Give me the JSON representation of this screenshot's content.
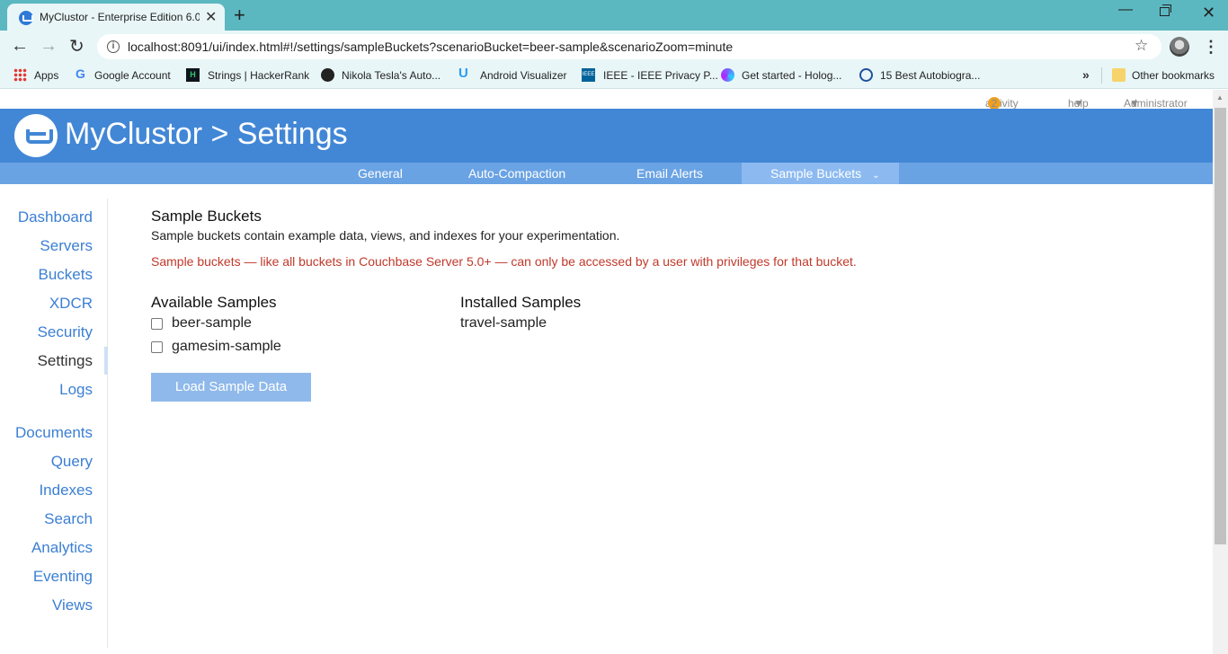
{
  "browser": {
    "tab_title": "MyClustor - Enterprise Edition 6.0",
    "url": "localhost:8091/ui/index.html#!/settings/sampleBuckets?scenarioBucket=beer-sample&scenarioZoom=minute",
    "bookmarks": [
      {
        "label": "Apps",
        "icon": "apps-icon"
      },
      {
        "label": "Google Account",
        "icon": "google-icon"
      },
      {
        "label": "Strings | HackerRank",
        "icon": "hackerrank-icon"
      },
      {
        "label": "Nikola Tesla's Auto...",
        "icon": "tesla-icon"
      },
      {
        "label": "Android Visualizer",
        "icon": "android-visualizer-icon"
      },
      {
        "label": "IEEE - IEEE Privacy P...",
        "icon": "ieee-icon"
      },
      {
        "label": "Get started - Holog...",
        "icon": "hologram-icon"
      },
      {
        "label": "15 Best Autobiogra...",
        "icon": "autobiography-icon"
      }
    ],
    "other_bookmarks": "Other bookmarks"
  },
  "topstrip": {
    "activity": "activity",
    "activity_count": "2",
    "help": "help",
    "user": "Administrator"
  },
  "header": {
    "title": "MyClustor > Settings"
  },
  "subnav": {
    "tabs": [
      {
        "label": "General"
      },
      {
        "label": "Auto-Compaction"
      },
      {
        "label": "Email Alerts"
      },
      {
        "label": "Sample Buckets"
      }
    ],
    "active": "Sample Buckets"
  },
  "sidenav": {
    "items": [
      {
        "label": "Dashboard"
      },
      {
        "label": "Servers"
      },
      {
        "label": "Buckets"
      },
      {
        "label": "XDCR"
      },
      {
        "label": "Security"
      },
      {
        "label": "Settings"
      },
      {
        "label": "Logs"
      },
      {
        "label": "Documents"
      },
      {
        "label": "Query"
      },
      {
        "label": "Indexes"
      },
      {
        "label": "Search"
      },
      {
        "label": "Analytics"
      },
      {
        "label": "Eventing"
      },
      {
        "label": "Views"
      }
    ],
    "active": "Settings"
  },
  "main": {
    "title": "Sample Buckets",
    "description": "Sample buckets contain example data, views, and indexes for your experimentation.",
    "warning": "Sample buckets — like all buckets in Couchbase Server 5.0+ — can only be accessed by a user with privileges for that bucket.",
    "available_heading": "Available Samples",
    "available": [
      {
        "label": "beer-sample",
        "checked": false
      },
      {
        "label": "gamesim-sample",
        "checked": false
      }
    ],
    "installed_heading": "Installed Samples",
    "installed": [
      "travel-sample"
    ],
    "load_button": "Load Sample Data"
  },
  "colors": {
    "header_bg": "#4287d6",
    "subnav_bg": "#6aa3e3",
    "subnav_active_bg": "#8cbaf0",
    "link": "#3b7fd3",
    "warning": "#c0392b",
    "button_disabled": "#8fb9ea",
    "chrome_bg": "#5cb8c0"
  }
}
